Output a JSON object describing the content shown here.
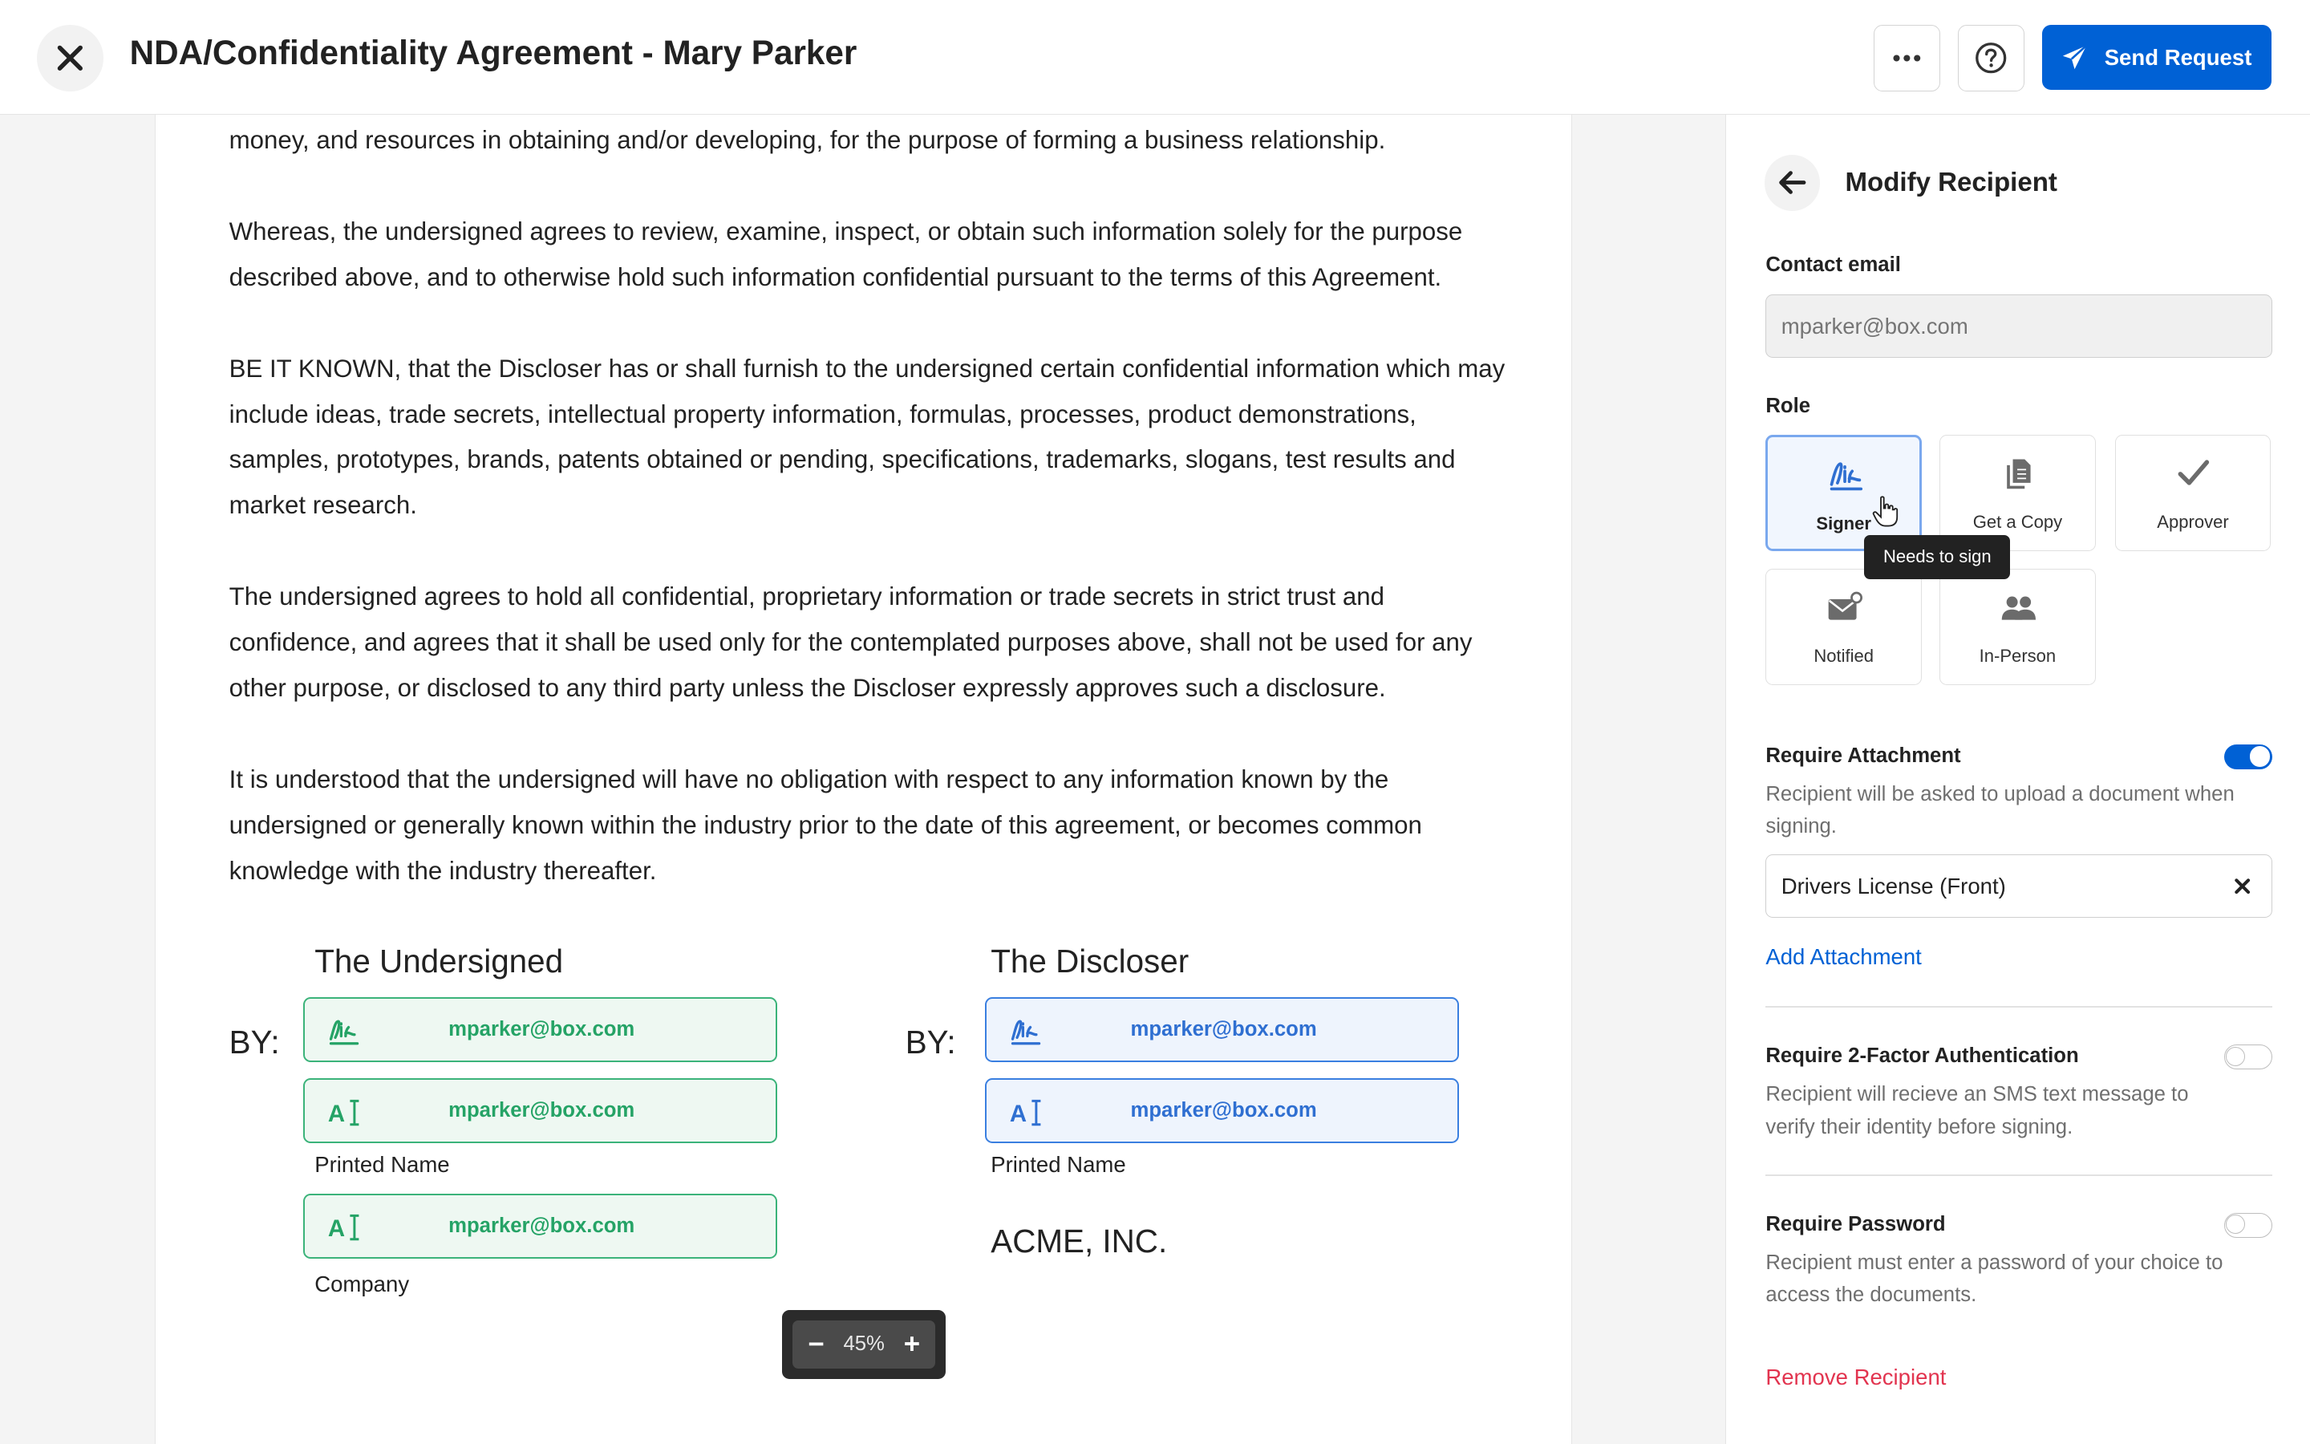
{
  "header": {
    "title": "NDA/Confidentiality Agreement - Mary Parker",
    "send_label": "Send Request"
  },
  "document": {
    "paragraphs": [
      "money, and resources in obtaining and/or developing, for the purpose of forming a business relationship.",
      "Whereas, the undersigned agrees to review, examine, inspect, or obtain such information solely for the purpose described above, and to otherwise hold such information confidential pursuant to the terms of this Agreement.",
      "BE IT KNOWN, that the Discloser has or shall furnish to the undersigned certain confidential information which may include ideas, trade secrets, intellectual property information, formulas, processes, product demonstrations, samples, prototypes, brands, patents obtained or pending, specifications, trademarks, slogans, test results and market research.",
      "The undersigned agrees to hold all confidential, proprietary information or trade secrets in strict trust and confidence, and agrees that it shall be used only for the contemplated purposes above, shall not be used for any other purpose, or disclosed to any third party unless the Discloser expressly approves such a disclosure.",
      "It is understood that the undersigned will have no obligation with respect to any information known by the undersigned or generally known within the industry prior to the date of this agreement, or becomes common knowledge with the industry thereafter."
    ],
    "undersigned": {
      "heading": "The Undersigned",
      "by_label": "BY:",
      "signature_field": "mparker@box.com",
      "name_field": "mparker@box.com",
      "name_caption": "Printed Name",
      "company_field": "mparker@box.com",
      "company_caption": "Company"
    },
    "discloser": {
      "heading": "The Discloser",
      "by_label": "BY:",
      "signature_field": "mparker@box.com",
      "name_field": "mparker@box.com",
      "name_caption": "Printed Name",
      "company_name": "ACME, INC."
    }
  },
  "zoom": {
    "value": "45%",
    "minus": "−",
    "plus": "+"
  },
  "panel": {
    "title": "Modify Recipient",
    "contact_email_label": "Contact email",
    "contact_email_placeholder": "mparker@box.com",
    "role_label": "Role",
    "roles": [
      {
        "label": "Signer",
        "icon": "signature-icon",
        "selected": true
      },
      {
        "label": "Get a Copy",
        "icon": "copy-icon",
        "selected": false
      },
      {
        "label": "Approver",
        "icon": "checkmark-icon",
        "selected": false
      },
      {
        "label": "Notified",
        "icon": "mail-notify-icon",
        "selected": false
      },
      {
        "label": "In-Person",
        "icon": "people-icon",
        "selected": false
      }
    ],
    "tooltip": "Needs to sign",
    "require_attachment": {
      "label": "Require Attachment",
      "enabled": true,
      "description": "Recipient will be asked to upload a document when signing.",
      "attachment_value": "Drivers License (Front)",
      "add_label": "Add Attachment"
    },
    "require_2fa": {
      "label": "Require 2-Factor Authentication",
      "enabled": false,
      "description": "Recipient will recieve an SMS text message to verify their identity before signing."
    },
    "require_password": {
      "label": "Require Password",
      "enabled": false,
      "description": "Recipient must enter a password of your choice to access the documents."
    },
    "remove_label": "Remove Recipient"
  },
  "colors": {
    "accent": "#0061d5",
    "signer_green": "#25a366",
    "discloser_blue": "#2f6fd1",
    "danger": "#e2344f"
  }
}
